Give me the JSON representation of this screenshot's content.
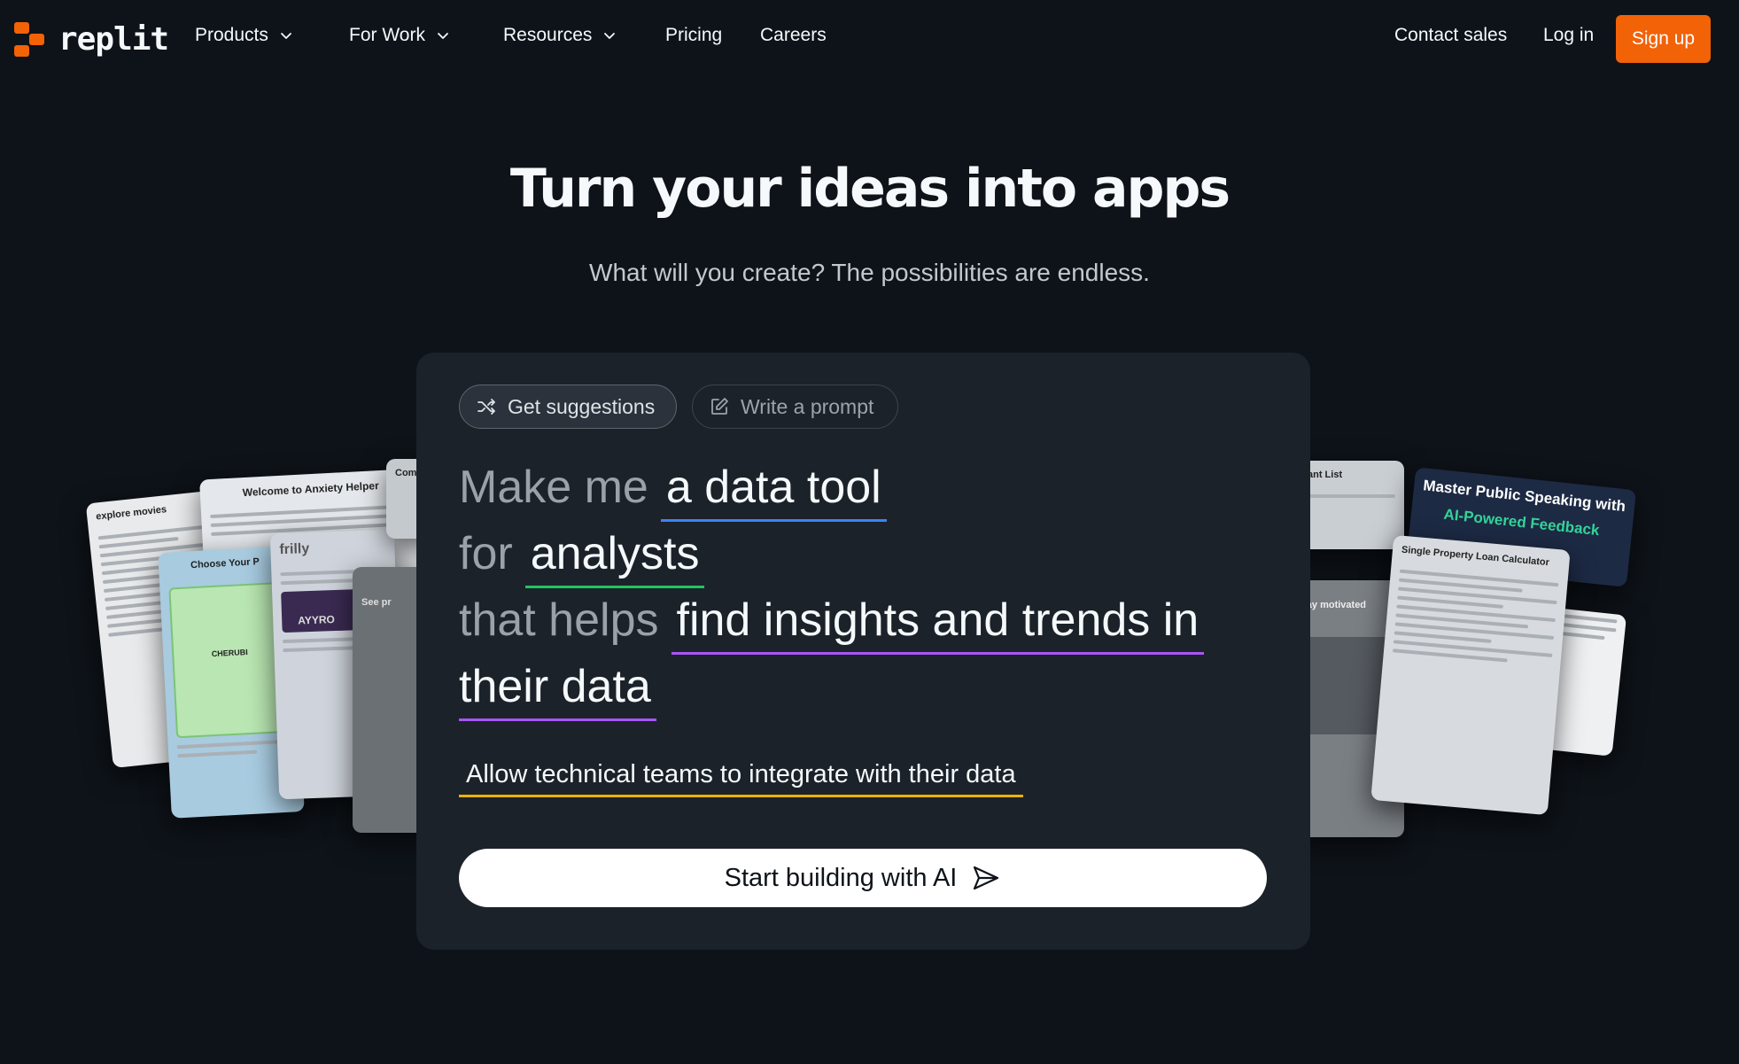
{
  "nav": {
    "logo_text": "replit",
    "items": [
      {
        "label": "Products"
      },
      {
        "label": "For Work"
      },
      {
        "label": "Resources"
      },
      {
        "label": "Pricing"
      },
      {
        "label": "Careers"
      }
    ],
    "contact_sales": "Contact sales",
    "login": "Log in",
    "signup": "Sign up"
  },
  "hero": {
    "title": "Turn your ideas into apps",
    "subtitle": "What will you create? The possibilities are endless."
  },
  "prompt": {
    "tabs": [
      {
        "label": "Get suggestions",
        "icon": "shuffle-icon",
        "active": true
      },
      {
        "label": "Write a prompt",
        "icon": "edit-icon",
        "active": false
      }
    ],
    "lines": [
      {
        "lead": "Make me",
        "value": "a data tool"
      },
      {
        "lead": "for",
        "value": "analysts"
      },
      {
        "lead": "that helps",
        "value": "find insights and trends in"
      },
      {
        "lead": "",
        "value": "their data"
      }
    ],
    "secondary": "Allow technical teams to integrate with their data",
    "cta": "Start building with AI"
  },
  "mocks": {
    "left": [
      {
        "title": "explore movies"
      },
      {
        "title": "Welcome to Anxiety Helper"
      },
      {
        "title": "Choose Your P"
      },
      {
        "title": "CHERUBI"
      },
      {
        "title": "frilly"
      },
      {
        "title": "AYYRO"
      },
      {
        "title": "Comp"
      },
      {
        "title": "See pr"
      }
    ],
    "right": [
      {
        "title": "grant List"
      },
      {
        "title": "stay motivated"
      },
      {
        "title": "Single Property Loan Calculator"
      },
      {
        "title": "Master Public Speaking with"
      },
      {
        "title": "AI-Powered Feedback"
      }
    ]
  },
  "colors": {
    "background": "#0e1319",
    "accent": "#f26207",
    "panel": "#1c2229",
    "underline_blue": "#3b82f6",
    "underline_green": "#22c55e",
    "underline_purple": "#a855f7",
    "underline_yellow": "#eab308"
  }
}
